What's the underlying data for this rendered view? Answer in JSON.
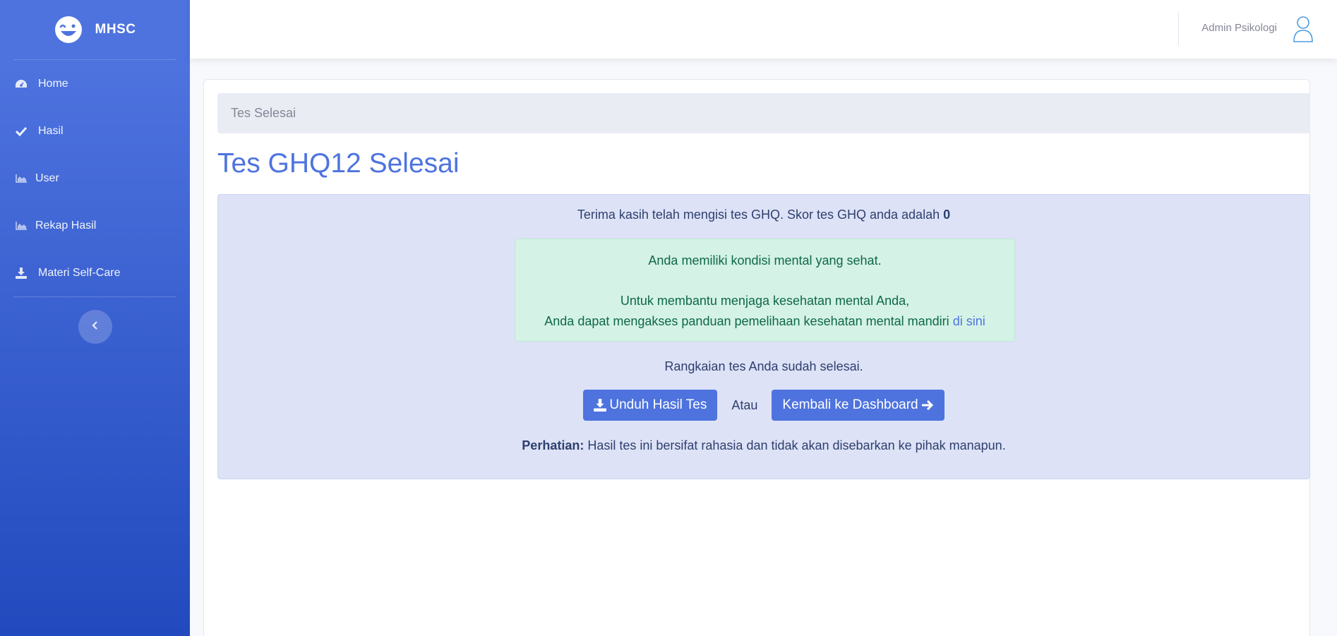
{
  "sidebar": {
    "brand": "MHSC",
    "items": [
      {
        "label": "Home",
        "icon": "dashboard-icon"
      },
      {
        "label": "Hasil",
        "icon": "check-icon"
      },
      {
        "label": "User",
        "icon": "chart-area-icon"
      },
      {
        "label": "Rekap Hasil",
        "icon": "chart-area-icon"
      },
      {
        "label": "Materi Self-Care",
        "icon": "download-icon"
      }
    ],
    "toggle_icon": "chevron-left-icon"
  },
  "topbar": {
    "user_name": "Admin Psikologi",
    "user_icon": "user-icon"
  },
  "main": {
    "breadcrumb": "Tes Selesai",
    "title": "Tes GHQ12 Selesai",
    "score_text": "Terima kasih telah mengisi tes GHQ. Skor tes GHQ anda adalah",
    "score_value": "0",
    "alert": {
      "line1": "Anda memiliki kondisi mental yang sehat.",
      "line2": "Untuk membantu menjaga kesehatan mental Anda,",
      "line3": "Anda dapat mengakses panduan pemelihaan kesehatan mental mandiri",
      "link": "di sini"
    },
    "done_text": "Rangkaian tes Anda sudah selesai.",
    "download_button": "Unduh Hasil Tes",
    "or_text": "Atau",
    "dashboard_button": "Kembali ke Dashboard",
    "note_label": "Perhatian:",
    "note_text": "Hasil tes ini bersifat rahasia dan tidak akan disebarkan ke pihak manapun."
  },
  "colors": {
    "primary": "#4e73df",
    "sidebar_bottom": "#224abe",
    "success_bg": "#d4f2e6",
    "success_text": "#0f6848"
  }
}
